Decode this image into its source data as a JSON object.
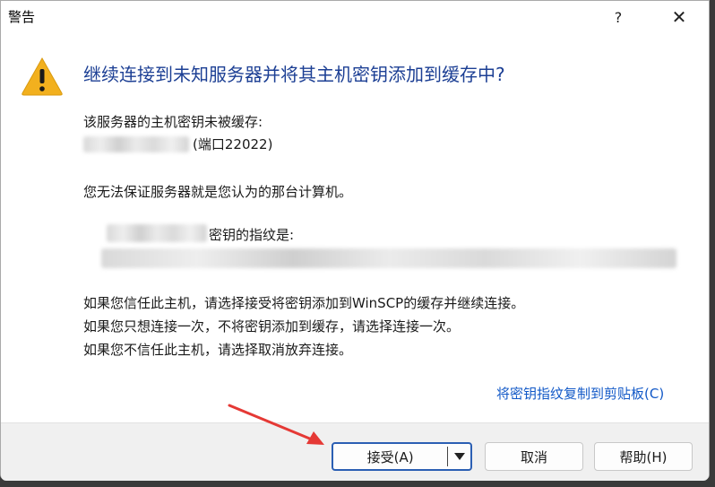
{
  "window": {
    "title": "警告",
    "help_glyph": "?",
    "close_glyph": "✕"
  },
  "icon": {
    "name": "warning-icon",
    "color": "#f2b01e"
  },
  "headline": "继续连接到未知服务器并将其主机密钥添加到缓存中?",
  "body": {
    "line1": "该服务器的主机密钥未被缓存:",
    "port_text": "(端口22022)",
    "line2": "您无法保证服务器就是您认为的那台计算机。",
    "fingerprint_label": "密钥的指纹是:",
    "instructions": [
      "如果您信任此主机，请选择接受将密钥添加到WinSCP的缓存并继续连接。",
      "如果您只想连接一次，不将密钥添加到缓存，请选择连接一次。",
      "如果您不信任此主机，请选择取消放弃连接。"
    ],
    "copy_link": "将密钥指纹复制到剪贴板(C)"
  },
  "buttons": {
    "accept": "接受(A)",
    "cancel": "取消",
    "help": "帮助(H)"
  },
  "colors": {
    "headline": "#1c3f94",
    "link": "#1158c7",
    "annotation_arrow": "#e53935",
    "default_button_border": "#2b5fb3"
  }
}
